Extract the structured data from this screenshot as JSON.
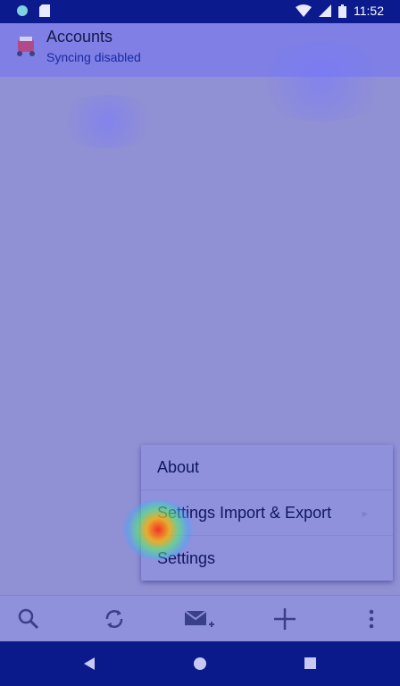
{
  "status_bar": {
    "time": "11:52",
    "left_icons": [
      "circle-notification-icon",
      "sd-card-icon"
    ],
    "right_icons": [
      "wifi-icon",
      "cell-signal-icon",
      "battery-icon"
    ]
  },
  "app_bar": {
    "title": "Accounts",
    "subtitle": "Syncing disabled",
    "icon": "app-logo-icon"
  },
  "menu": {
    "items": [
      {
        "label": "About",
        "has_submenu": false
      },
      {
        "label": "Settings Import & Export",
        "has_submenu": true
      },
      {
        "label": "Settings",
        "has_submenu": false
      }
    ]
  },
  "toolbar": {
    "buttons": [
      "search-icon",
      "refresh-icon",
      "compose-icon",
      "add-icon",
      "more-vert-icon"
    ]
  },
  "nav_bar": {
    "buttons": [
      "back-icon",
      "home-icon",
      "recents-icon"
    ]
  },
  "colors": {
    "status_bar": "#0b1a8c",
    "app_bar": "#7f7fe6",
    "content": "#9090d4",
    "heat_hotspot": "#ff2814"
  }
}
